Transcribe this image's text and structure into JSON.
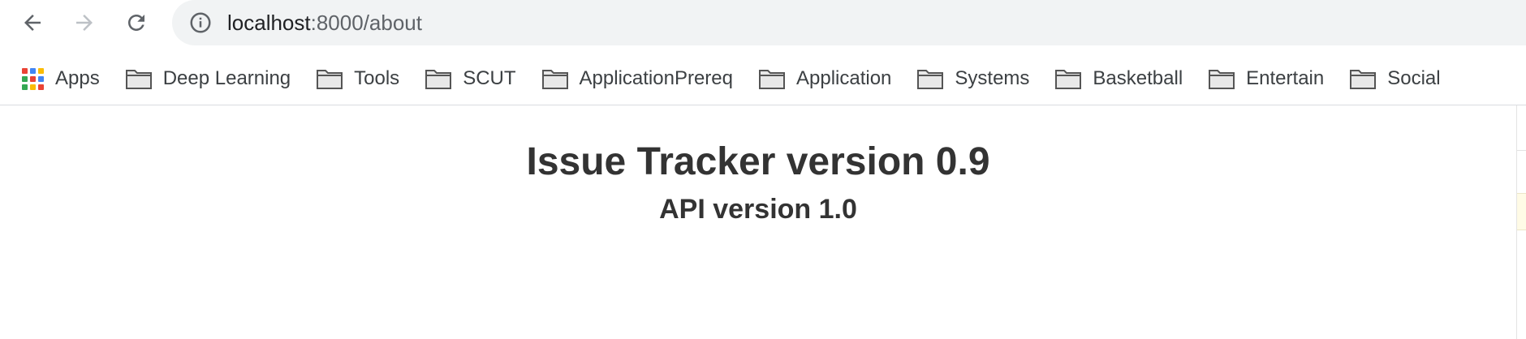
{
  "browser": {
    "url_host": "localhost",
    "url_rest": ":8000/about"
  },
  "bookmarks": [
    {
      "label": "Apps",
      "icon": "apps-grid-icon"
    },
    {
      "label": "Deep Learning",
      "icon": "folder-icon"
    },
    {
      "label": "Tools",
      "icon": "folder-icon"
    },
    {
      "label": "SCUT",
      "icon": "folder-icon"
    },
    {
      "label": "ApplicationPrereq",
      "icon": "folder-icon"
    },
    {
      "label": "Application",
      "icon": "folder-icon"
    },
    {
      "label": "Systems",
      "icon": "folder-icon"
    },
    {
      "label": "Basketball",
      "icon": "folder-icon"
    },
    {
      "label": "Entertain",
      "icon": "folder-icon"
    },
    {
      "label": "Social",
      "icon": "folder-icon"
    }
  ],
  "page": {
    "title": "Issue Tracker version 0.9",
    "subtitle": "API version 1.0"
  },
  "colors": {
    "toolbar_bg": "#ffffff",
    "omnibox_bg": "#f1f3f4",
    "heading_text": "#333333",
    "apps_colors": [
      "#ea4335",
      "#4285f4",
      "#fbbc05",
      "#34a853",
      "#ea4335",
      "#4285f4",
      "#34a853",
      "#fbbc05",
      "#ea4335"
    ]
  }
}
